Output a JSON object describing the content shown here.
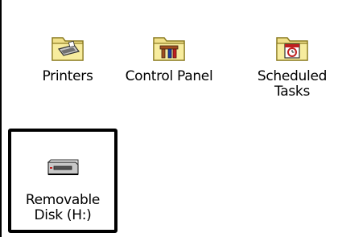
{
  "window": {
    "items": [
      {
        "label": "Printers",
        "icon": "printers-folder-icon"
      },
      {
        "label": "Control Panel",
        "icon": "control-panel-folder-icon"
      },
      {
        "label": "Scheduled\nTasks",
        "icon": "scheduled-tasks-folder-icon"
      },
      {
        "label": "Removable\nDisk (H:)",
        "icon": "removable-disk-icon",
        "selected": true
      }
    ]
  },
  "colors": {
    "folder_yellow": "#f0e08a",
    "folder_dark": "#8a7a20",
    "selection_border": "#000000",
    "background": "#ffffff"
  }
}
